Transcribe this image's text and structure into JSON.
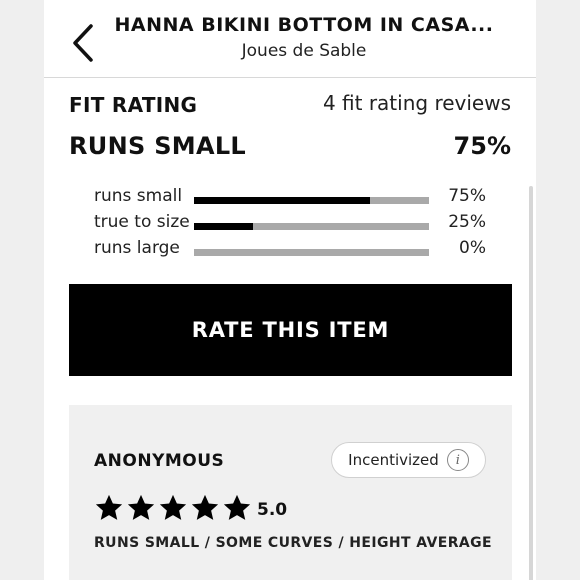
{
  "header": {
    "title": "HANNA BIKINI BOTTOM IN CASA...",
    "brand": "Joues de Sable",
    "back_icon": "chevron-left-icon"
  },
  "fit": {
    "heading": "FIT RATING",
    "review_count": "4 fit rating reviews",
    "verdict": "RUNS SMALL",
    "verdict_percent": "75%",
    "rows": [
      {
        "label": "runs small",
        "percent": "75%",
        "fraction": 0.75
      },
      {
        "label": "true to size",
        "percent": "25%",
        "fraction": 0.25
      },
      {
        "label": "runs large",
        "percent": "0%",
        "fraction": 0
      }
    ]
  },
  "rate_button": {
    "label": "RATE THIS ITEM"
  },
  "review": {
    "reviewer": "ANONYMOUS",
    "badge": "Incentivized",
    "info_icon": "info-icon",
    "stars": 5,
    "rating": "5.0",
    "fit_note": "RUNS SMALL / SOME CURVES / HEIGHT AVERAGE"
  },
  "colors": {
    "bar_fill": "#000000",
    "bar_track": "#a9a9a9",
    "button_bg": "#000000",
    "card_bg": "#f0f0f0"
  }
}
